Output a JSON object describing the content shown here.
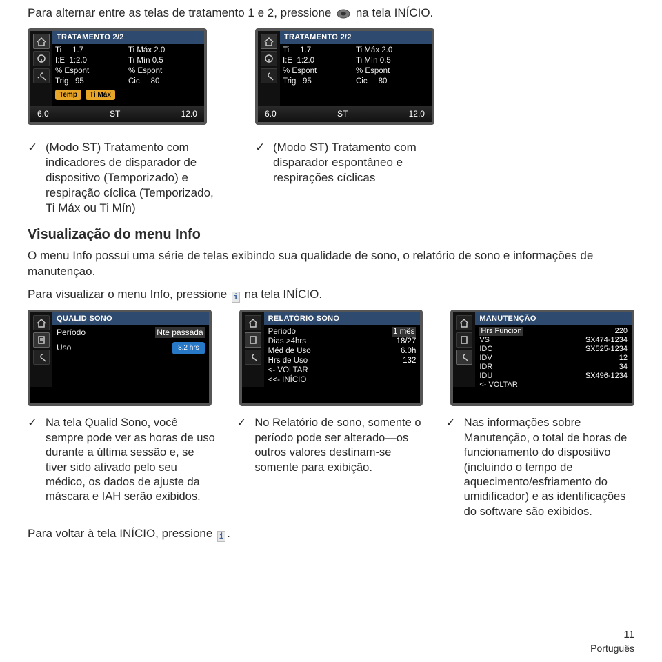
{
  "intro": {
    "prefix": "Para alternar entre as telas de tratamento 1 e 2, pressione",
    "suffix": "na tela INÍCIO."
  },
  "device_top": {
    "title": "TRATAMENTO 2/2",
    "rows": [
      [
        "Ti",
        "1.7",
        "Ti Máx",
        "2.0"
      ],
      [
        "I:E",
        "1:2.0",
        "Ti Mín",
        "0.5"
      ],
      [
        "% Espont",
        "",
        "% Espont",
        ""
      ],
      [
        "Trig",
        "95",
        "Cic",
        "80"
      ]
    ],
    "pills_a": [
      "Temp",
      "Ti Máx"
    ],
    "footer": [
      "6.0",
      "ST",
      "12.0"
    ]
  },
  "captions_top": {
    "left": "(Modo ST) Tratamento com indicadores de disparador de dispositivo (Temporizado) e respiração cíclica (Temporizado, Ti Máx ou Ti Mín)",
    "right": "(Modo ST) Tratamento com disparador espontâneo e respirações cíclicas"
  },
  "info_section": {
    "heading": "Visualização do menu Info",
    "body": "O menu Info possui uma série de telas exibindo sua qualidade de sono, o relatório de sono e informações de manutençao.",
    "press_prefix": "Para visualizar o menu Info, pressione",
    "press_suffix": "na tela INÍCIO."
  },
  "device_mid": {
    "qualid": {
      "title": "QUALID SONO",
      "row1_label": "Período",
      "row1_value": "Nte passada",
      "row2_label": "Uso",
      "row2_value": "8.2 hrs"
    },
    "relatorio": {
      "title": "RELATÓRIO SONO",
      "rows": [
        [
          "Período",
          "1 mês"
        ],
        [
          "Dias >4hrs",
          "18/27"
        ],
        [
          "Méd de Uso",
          "6.0h"
        ],
        [
          "Hrs de Uso",
          "132"
        ],
        [
          "<- VOLTAR",
          ""
        ],
        [
          "<<- INÍCIO",
          ""
        ]
      ]
    },
    "manut": {
      "title": "MANUTENÇÃO",
      "rows": [
        [
          "Hrs Funcion",
          "220"
        ],
        [
          "VS",
          "SX474-1234"
        ],
        [
          "IDC",
          "SX525-1234"
        ],
        [
          "IDV",
          "12"
        ],
        [
          "IDR",
          "34"
        ],
        [
          "IDU",
          "SX496-1234"
        ],
        [
          "<- VOLTAR",
          ""
        ]
      ]
    }
  },
  "captions_bottom": {
    "left": "Na tela Qualid Sono, você sempre pode ver as horas de uso durante a última sessão e, se tiver sido ativado pelo seu médico, os dados de ajuste da máscara e IAH serão exibidos.",
    "mid": "No Relatório de sono, somente o período pode ser alterado—os outros valores destinam-se somente para exibição.",
    "right": "Nas informações sobre Manutenção, o total de horas de funcionamento do dispositivo (incluindo o tempo de aquecimento/esfriamento do umidificador) e as identificações do software são exibidos."
  },
  "back_line": {
    "prefix": "Para voltar à tela INÍCIO, pressione",
    "suffix": "."
  },
  "footer": {
    "page": "11",
    "lang": "Português"
  },
  "icons": {
    "home": "home-icon",
    "info": "info-icon",
    "wrench": "wrench-icon",
    "clipboard": "clipboard-icon"
  }
}
